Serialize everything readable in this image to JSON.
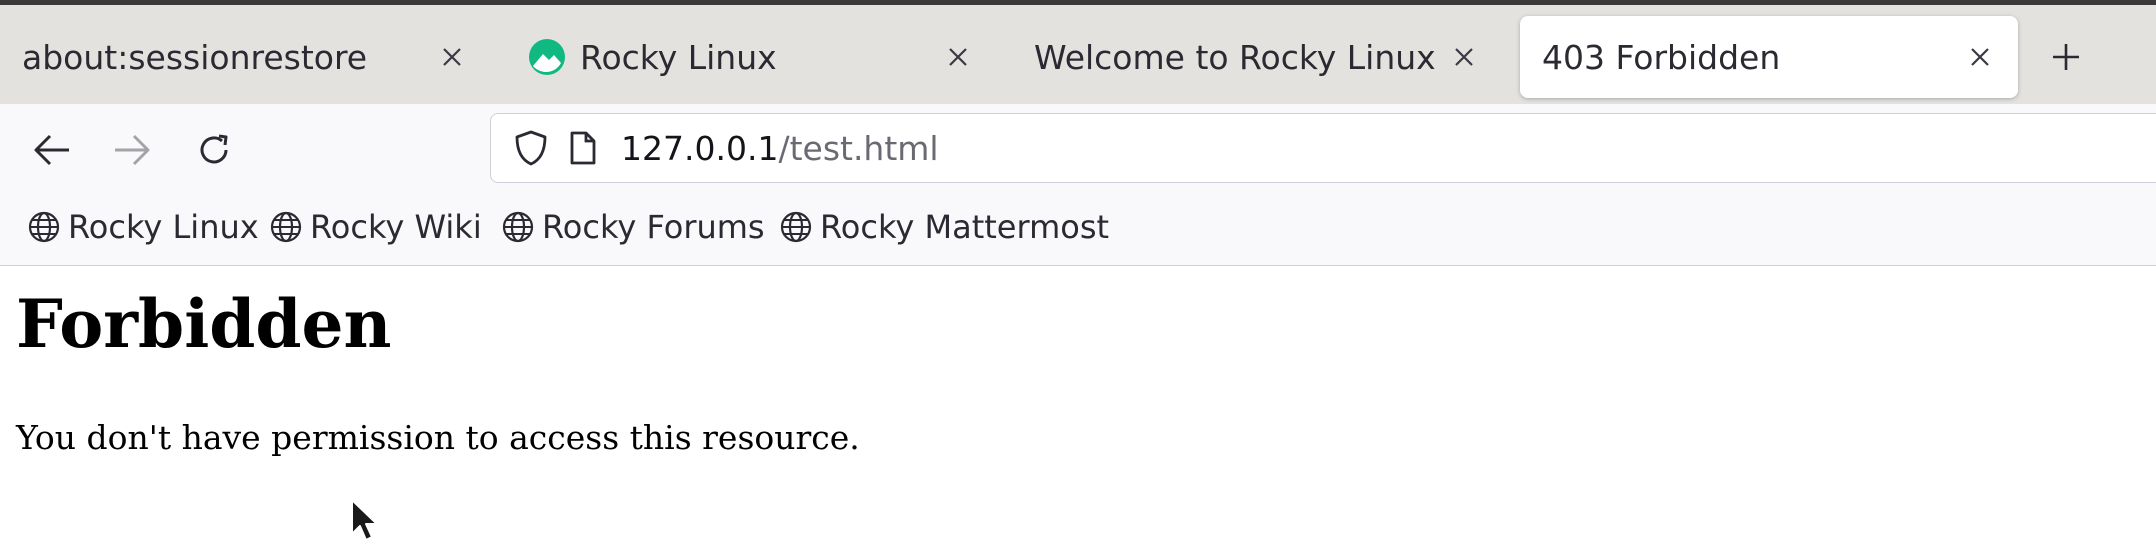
{
  "tabs": [
    {
      "label": "about:sessionrestore",
      "has_favicon": false,
      "active": false
    },
    {
      "label": "Rocky Linux",
      "has_favicon": true,
      "active": false
    },
    {
      "label": "Welcome to Rocky Linux",
      "has_favicon": false,
      "active": false
    },
    {
      "label": "403 Forbidden",
      "has_favicon": false,
      "active": true
    }
  ],
  "navbar": {
    "url_host": "127.0.0.1",
    "url_path": "/test.html"
  },
  "bookmarks": [
    {
      "label": "Rocky Linux"
    },
    {
      "label": "Rocky Wiki"
    },
    {
      "label": "Rocky Forums"
    },
    {
      "label": "Rocky Mattermost"
    }
  ],
  "page": {
    "heading": "Forbidden",
    "message": "You don't have permission to access this resource."
  },
  "colors": {
    "tabstrip_bg": "#e4e2df",
    "toolbar_bg": "#f9f9fb",
    "rocky_green": "#10b981"
  },
  "icons": {
    "close": "close-icon",
    "new_tab": "plus-icon",
    "back": "back-arrow-icon",
    "forward": "forward-arrow-icon",
    "reload": "reload-icon",
    "shield": "shield-icon",
    "page": "page-icon",
    "globe": "globe-icon",
    "cursor": "mouse-cursor-icon"
  }
}
